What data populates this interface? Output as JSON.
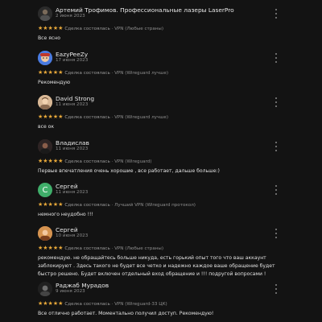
{
  "reviews": [
    {
      "author": "Артемий Трофимов. Профессиональные лазеры LaserPro",
      "date": "2 июня 2023",
      "rating_stars": "★★★★★",
      "verified": "Сделка состоялась",
      "product": "VPN (Любые страны)",
      "text": "Все ясно",
      "avatar_color": "#2a2a2a",
      "avatar_icon": "photo-avatar"
    },
    {
      "author": "EazyPeeZy",
      "date": "17 июня 2023",
      "rating_stars": "★★★★★",
      "verified": "Сделка состоялась",
      "product": "VPN (Wireguard лучше)",
      "text": "Рекомендую",
      "avatar_color": "#3c64c8",
      "avatar_icon": "cartoon-avatar"
    },
    {
      "author": "David Strong",
      "date": "11 июня 2023",
      "rating_stars": "★★★★★",
      "verified": "Сделка состоялась",
      "product": "VPN (Wireguard лучше)",
      "text": "все ок",
      "avatar_color": "#c9a27a",
      "avatar_icon": "photo-avatar"
    },
    {
      "author": "Владислав",
      "date": "11 июня 2023",
      "rating_stars": "★★★★★",
      "verified": "Сделка состоялась",
      "product": "VPN (Wireguard)",
      "text": "Первые впечатления очень хорошие , все работает, дальше больше:)",
      "avatar_color": "#3a3030",
      "avatar_icon": "photo-avatar"
    },
    {
      "author": "Сергей",
      "date": "11 июня 2023",
      "rating_stars": "★★★★★",
      "verified": "Сделка состоялась",
      "product": "Лучший VPN (Wireguard протокол)",
      "text": "немного неудобно !!!",
      "avatar_color": "#3fae6a",
      "avatar_icon": "letter-avatar",
      "avatar_letter": "С"
    },
    {
      "author": "Сергей",
      "date": "10 июня 2023",
      "rating_stars": "★★★★★",
      "verified": "Сделка состоялась",
      "product": "VPN (Любые страны)",
      "text": "рекомендую. не обращайтесь больше никуда, есть горький опыт того что ваш аккаунт заблокируют . Здесь такого не будет все четко и надежно каждое ваше обращение будет быстро решено. Будет включен отдельный вход обращение и !!! подругой вопросами !",
      "avatar_color": "#c07a3a",
      "avatar_icon": "photo-avatar"
    },
    {
      "author": "Раджаб Мурадов",
      "date": "9 июня 2023",
      "rating_stars": "★★★★★",
      "verified": "Сделка состоялась",
      "product": "VPN (Wireguard-33 ЦК)",
      "text": "Все отлично работает. Моментально получил доступ. Рекомендую!",
      "avatar_color": "#1e1e1e",
      "avatar_icon": "photo-avatar"
    }
  ]
}
